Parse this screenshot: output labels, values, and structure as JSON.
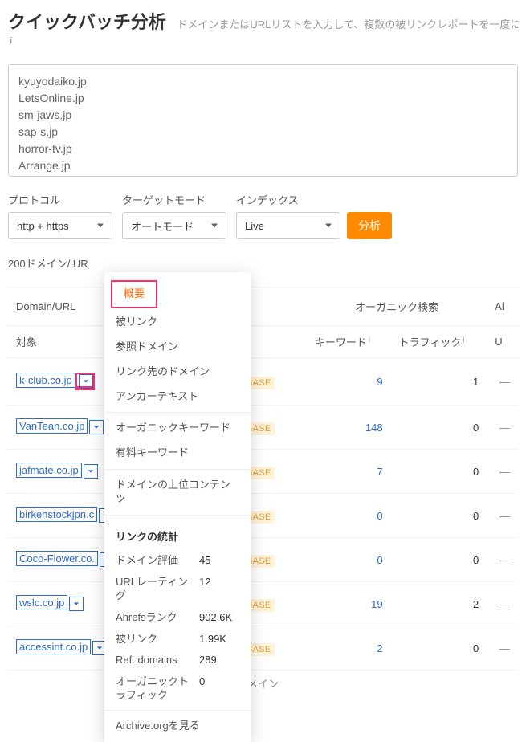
{
  "header": {
    "title": "クイックバッチ分析",
    "subtitle": "ドメインまたはURLリストを入力して、複数の被リンクレポートを一度に"
  },
  "input": {
    "value": "kyuyodaiko.jp\nLetsOnline.jp\nsm-jaws.jp\nsap-s.jp\nhorror-tv.jp\nArrange.jp"
  },
  "controls": {
    "protocol_label": "プロトコル",
    "protocol_value": "http + https",
    "target_label": "ターゲットモード",
    "target_value": "オートモード",
    "index_label": "インデックス",
    "index_value": "Live",
    "analyze": "分析"
  },
  "status": "200ドメイン/ UR",
  "table": {
    "col_domain": "Domain/URL",
    "col_organic": "オーガニック検索",
    "col_al": "Al",
    "col_target": "対象",
    "col_keywords": "キーワード",
    "col_traffic": "トラフィック",
    "col_u": "U",
    "notfound": "FOUND IN OUR DATABASE",
    "rows": [
      {
        "domain": "k-club.co.jp",
        "kw": "9",
        "tr": "1",
        "u": "—"
      },
      {
        "domain": "VanTean.co.jp",
        "kw": "148",
        "tr": "0",
        "u": "—"
      },
      {
        "domain": "jafmate.co.jp",
        "kw": "7",
        "tr": "0",
        "u": "—"
      },
      {
        "domain": "birkenstockjpn.c",
        "kw": "0",
        "tr": "0",
        "u": "—"
      },
      {
        "domain": "Coco-Flower.co.",
        "kw": "0",
        "tr": "0",
        "u": "—"
      },
      {
        "domain": "wslc.co.jp",
        "kw": "19",
        "tr": "2",
        "u": "—"
      },
      {
        "domain": "accessint.co.jp",
        "kw": "2",
        "tr": "0",
        "u": "—"
      }
    ],
    "trailing": "メイン"
  },
  "dropdown": {
    "overview": "概要",
    "backlinks": "被リンク",
    "ref_domains": "参照ドメイン",
    "linked_domains": "リンク先のドメイン",
    "anchor": "アンカーテキスト",
    "org_kw": "オーガニックキーワード",
    "paid_kw": "有料キーワード",
    "top_content": "ドメインの上位コンテンツ",
    "stats_title": "リンクの統計",
    "stats": [
      {
        "k": "ドメイン評価",
        "v": "45"
      },
      {
        "k": "URLレーティング",
        "v": "12"
      },
      {
        "k": "Ahrefsランク",
        "v": "902.6K"
      },
      {
        "k": "被リンク",
        "v": "1.99K"
      },
      {
        "k": "Ref. domains",
        "v": "289"
      },
      {
        "k": "オーガニックトラフィック",
        "v": "0"
      }
    ],
    "archive": "Archive.orgを見る"
  }
}
